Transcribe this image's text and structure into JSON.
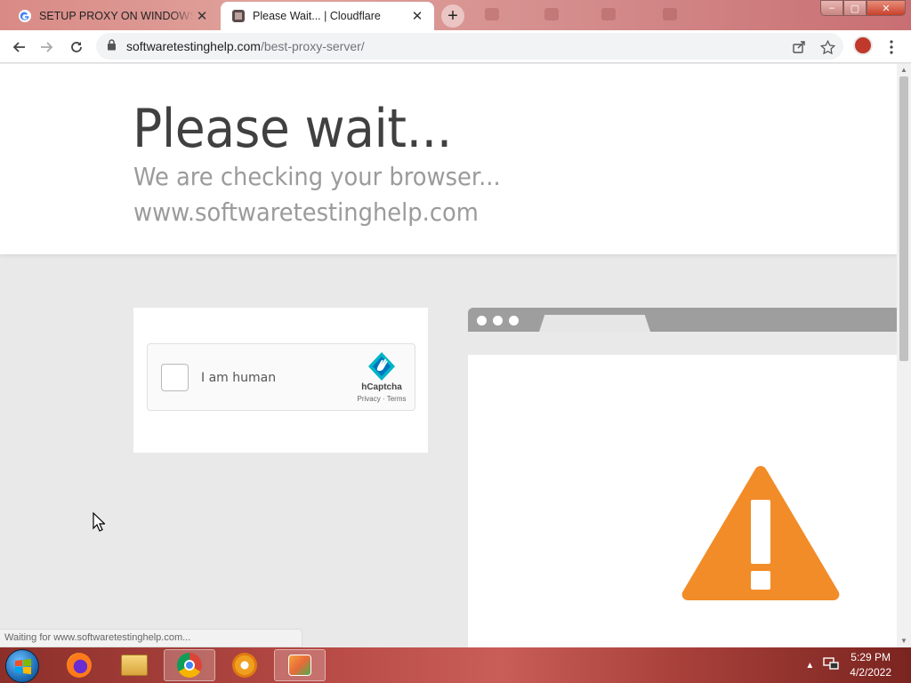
{
  "browser": {
    "tabs": [
      {
        "title": "SETUP PROXY ON WINDOWS - C",
        "active": false
      },
      {
        "title": "Please Wait... | Cloudflare",
        "active": true
      }
    ],
    "new_tab_symbol": "+",
    "close_symbol": "✕",
    "address": {
      "host": "softwaretestinghelp.com",
      "path": "/best-proxy-server/"
    },
    "window_buttons": {
      "minimize": "–",
      "maximize": "▢",
      "close": "✕"
    }
  },
  "page": {
    "heading": "Please wait...",
    "subheading": "We are checking your browser...",
    "domain": "www.softwaretestinghelp.com",
    "captcha": {
      "checkbox_label": "I am human",
      "brand": "hCaptcha",
      "links": "Privacy · Terms"
    }
  },
  "statusbar": {
    "text": "Waiting for www.softwaretestinghelp.com..."
  },
  "taskbar": {
    "apps": [
      "firefox",
      "file-explorer",
      "chrome",
      "vpn-shield",
      "app-window"
    ],
    "clock_time": "5:29 PM",
    "clock_date": "4/2/2022"
  },
  "colors": {
    "warning": "#f28c28",
    "illus_bar": "#9e9e9e"
  }
}
